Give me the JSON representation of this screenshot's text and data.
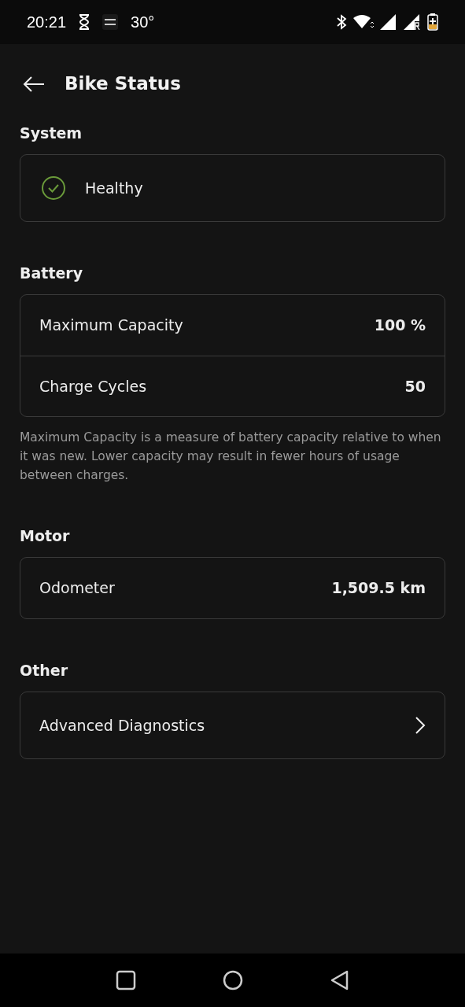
{
  "status_bar": {
    "time": "20:21",
    "temperature": "30°"
  },
  "header": {
    "title": "Bike Status"
  },
  "sections": [
    {
      "title": "System",
      "rows": [
        {
          "kind": "status",
          "label": "Healthy"
        }
      ]
    },
    {
      "title": "Battery",
      "rows": [
        {
          "kind": "value",
          "label": "Maximum Capacity",
          "value": "100 %"
        },
        {
          "kind": "value",
          "label": "Charge Cycles",
          "value": "50"
        }
      ],
      "note": "Maximum Capacity is a measure of battery capacity relative to when it was new. Lower capacity may result in fewer hours of usage between charges."
    },
    {
      "title": "Motor",
      "rows": [
        {
          "kind": "value",
          "label": "Odometer",
          "value": "1,509.5 km"
        }
      ]
    },
    {
      "title": "Other",
      "rows": [
        {
          "kind": "link",
          "label": "Advanced Diagnostics"
        }
      ]
    }
  ]
}
